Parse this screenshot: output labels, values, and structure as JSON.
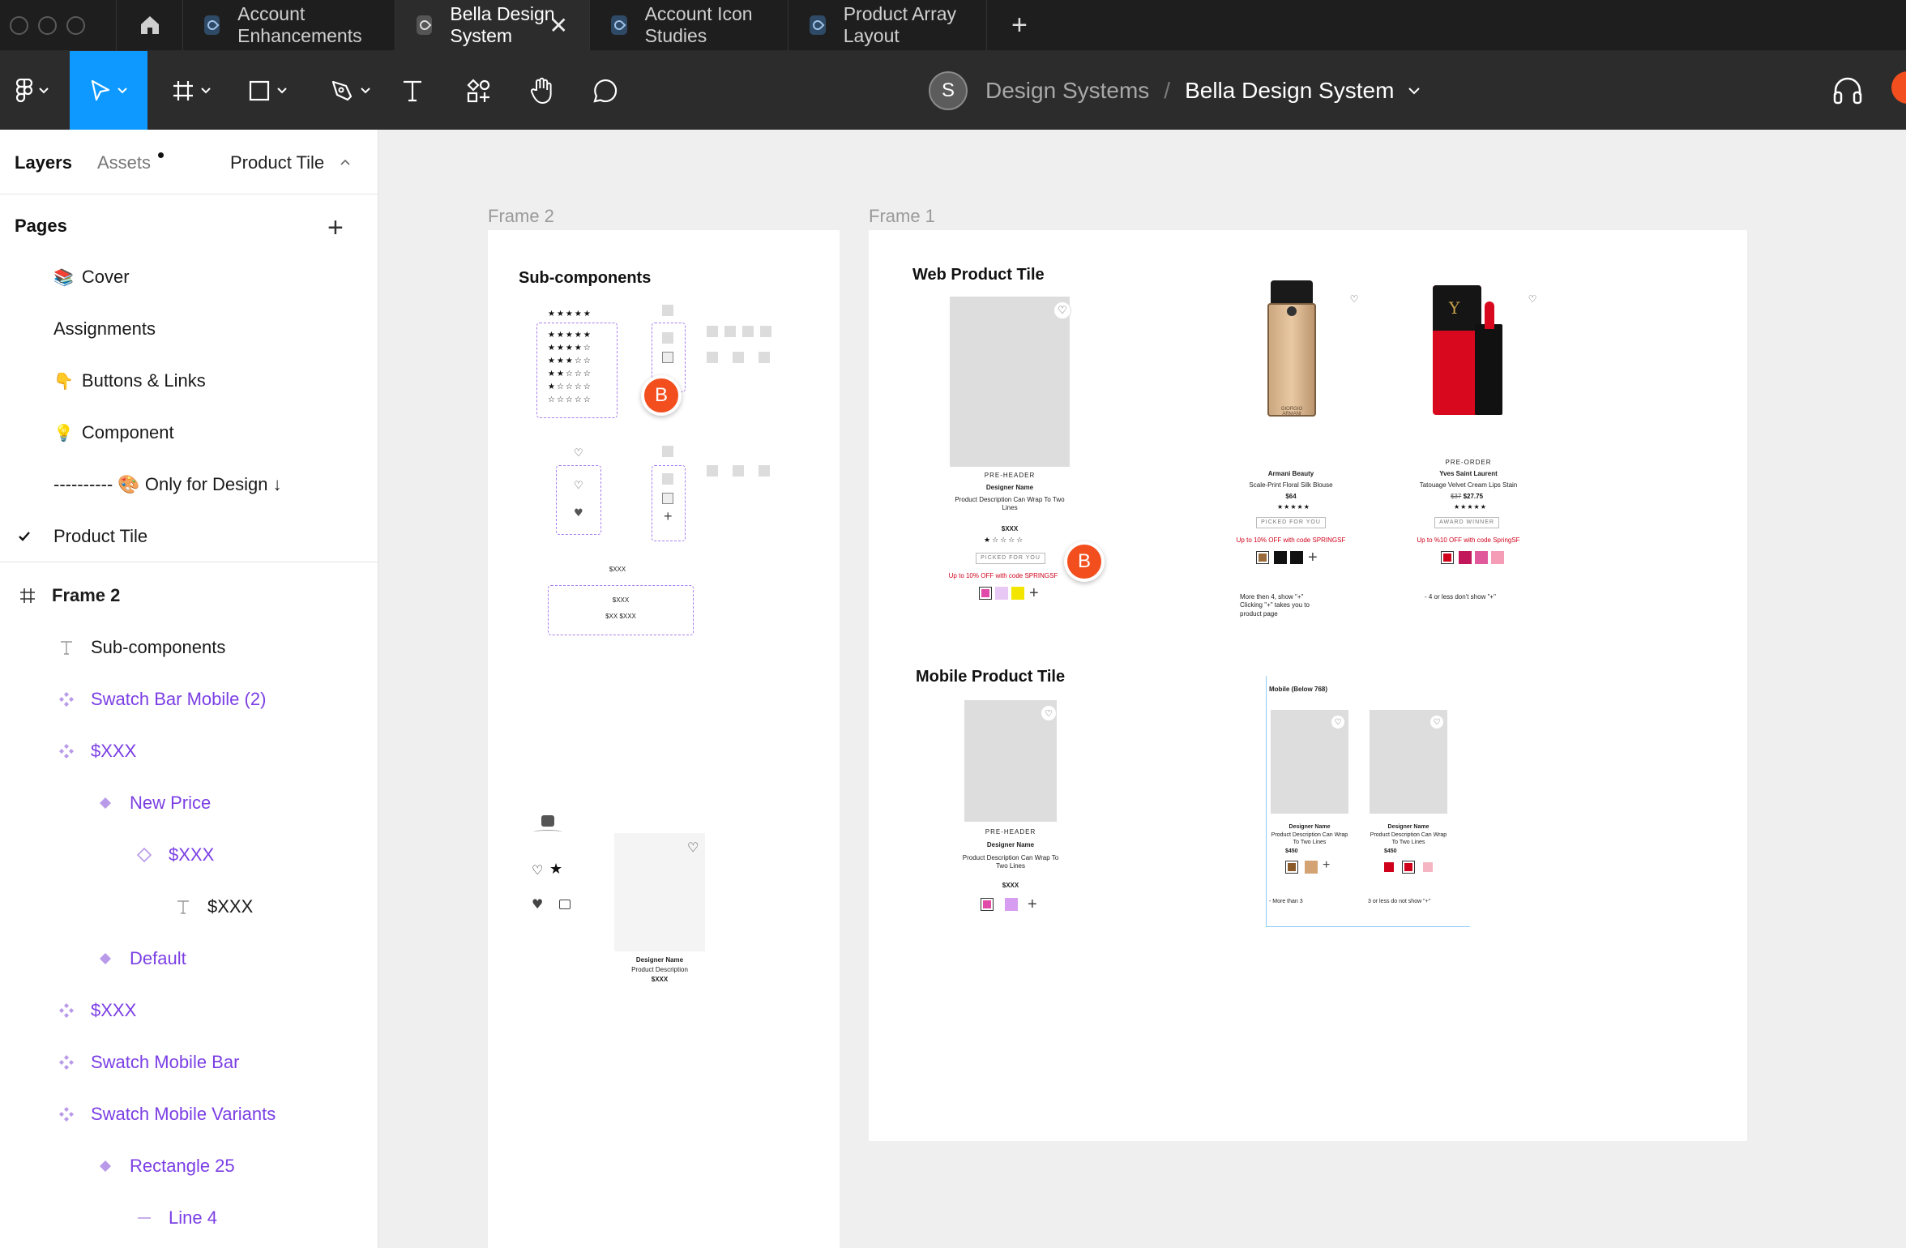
{
  "tabs": {
    "items": [
      {
        "label": "Account Enhancements"
      },
      {
        "label": "Bella Design System",
        "active": true
      },
      {
        "label": "Account Icon Studies"
      },
      {
        "label": "Product Array Layout"
      }
    ],
    "close_glyph": "✕",
    "new_tab_glyph": "+"
  },
  "toolbar": {
    "avatar_initial": "S",
    "project": "Design Systems",
    "separator": "/",
    "file": "Bella Design System",
    "accent": "#0d99ff"
  },
  "left_panel": {
    "tab_layers": "Layers",
    "tab_assets": "Assets",
    "current_page": "Product Tile",
    "pages_title": "Pages",
    "add_page": "+",
    "pages": [
      {
        "emoji": "📚",
        "label": "Cover"
      },
      {
        "emoji": "",
        "label": "Assignments"
      },
      {
        "emoji": "👇",
        "label": "Buttons & Links"
      },
      {
        "emoji": "💡",
        "label": "Component"
      },
      {
        "emoji": "",
        "label": "---------- 🎨  Only for Design ↓"
      },
      {
        "emoji": "",
        "label": "Product Tile",
        "selected": true
      }
    ],
    "layers": [
      {
        "label": "Frame 2",
        "type": "frame",
        "indent": 0
      },
      {
        "label": "Sub-components",
        "type": "text",
        "indent": 1
      },
      {
        "label": "Swatch Bar Mobile (2)",
        "type": "component-set",
        "indent": 1
      },
      {
        "label": "$XXX",
        "type": "component-set",
        "indent": 1
      },
      {
        "label": "New Price",
        "type": "component",
        "indent": 2
      },
      {
        "label": "$XXX",
        "type": "instance",
        "indent": 3
      },
      {
        "label": "$XXX",
        "type": "text",
        "indent": 4
      },
      {
        "label": "Default",
        "type": "component",
        "indent": 2
      },
      {
        "label": "$XXX",
        "type": "component-set",
        "indent": 1
      },
      {
        "label": "Swatch Mobile Bar",
        "type": "component-set",
        "indent": 1
      },
      {
        "label": "Swatch Mobile Variants",
        "type": "component-set",
        "indent": 1
      },
      {
        "label": "Rectangle 25",
        "type": "component",
        "indent": 2
      },
      {
        "label": "Line 4",
        "type": "line",
        "indent": 3
      }
    ],
    "component_color": "#7b3fe4"
  },
  "canvas": {
    "frame2": {
      "label": "Frame 2",
      "heading": "Sub-components",
      "price_single": "$XXX",
      "price_box_new": "$XXX",
      "price_box_old": "$XX $XXX",
      "tile_designer": "Designer Name",
      "tile_desc": "Product Description",
      "tile_price": "$XXX"
    },
    "frame1": {
      "label": "Frame 1",
      "web_heading": "Web Product Tile",
      "mobile_heading": "Mobile Product Tile",
      "web_template": {
        "preheader": "PRE-HEADER",
        "designer": "Designer Name",
        "desc": "Product Description Can Wrap To Two Lines",
        "price": "$XXX",
        "stars": "★☆☆☆☆",
        "badge": "PICKED FOR YOU",
        "promo": "Up to 10% OFF with code SPRINGSF"
      },
      "armani": {
        "brand": "Armani Beauty",
        "name": "Scale-Print Floral Silk Blouse",
        "price": "$64",
        "stars": "★★★★★",
        "badge": "PICKED FOR YOU",
        "promo": "Up to 10% OFF with code SPRINGSF",
        "note": "More then 4, show \"+\"\nClicking \"+\" takes you to\nproduct page",
        "swatches": [
          "#9a6a3a",
          "#111111",
          "#111111"
        ]
      },
      "ysl": {
        "preheader": "PRE-ORDER",
        "brand": "Yves Saint Laurent",
        "name": "Tatouage Velvet Cream Lips Stain",
        "old_price": "$37",
        "price": "$27.75",
        "stars": "★★★★★",
        "badge": "AWARD WINNER",
        "promo": "Up to %10 OFF with code SpringSF",
        "note": "- 4 or less don't show \"+\"",
        "swatches": [
          "#d0021b",
          "#c2185b",
          "#e05a9b",
          "#f59cb6"
        ]
      },
      "web_swatches": [
        "#e04aa8",
        "#e8c9f5",
        "#f2e600"
      ],
      "mobile_template": {
        "preheader": "PRE-HEADER",
        "designer": "Designer Name",
        "desc": "Product Description Can Wrap To Two Lines",
        "price": "$XXX",
        "swatches": [
          "#e04aa8",
          "#d69df0"
        ]
      },
      "mobile_examples": {
        "title": "Mobile (Below 768)",
        "tile1": {
          "designer": "Designer Name",
          "desc": "Product Description Can Wrap To Two Lines",
          "price": "$450",
          "note": "- More than 3",
          "swatches": [
            "#8a5a2b",
            "#d4a373"
          ]
        },
        "tile2": {
          "designer": "Designer Name",
          "desc": "Product Description Can Wrap To Two Lines",
          "price": "$450",
          "note": "3 or less do not show \"+\"",
          "swatches": [
            "#d0021b",
            "#d0021b",
            "#f5b5c2"
          ]
        }
      }
    },
    "collaborator_initial": "B",
    "collaborator_color": "#f24e1e"
  }
}
